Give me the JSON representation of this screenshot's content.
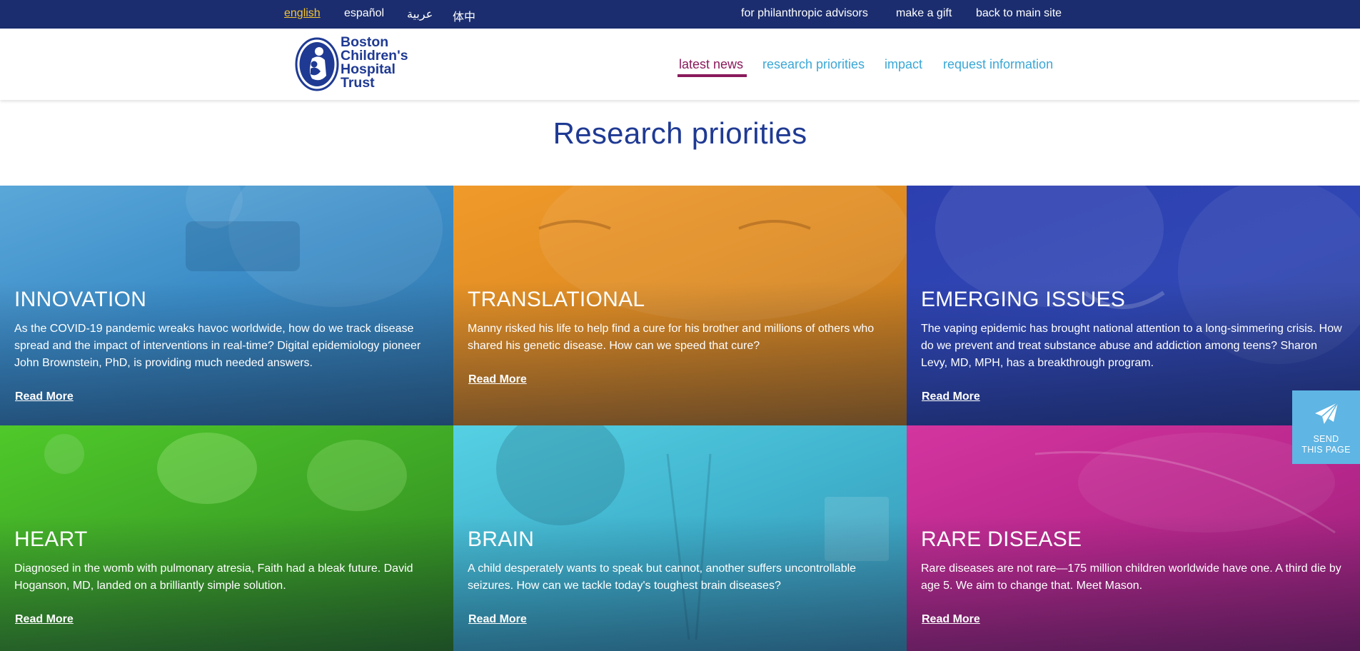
{
  "topbar": {
    "languages": [
      "english",
      "español",
      "عربية",
      "体中"
    ],
    "links": [
      "for philanthropic advisors",
      "make a gift",
      "back to main site"
    ]
  },
  "header": {
    "logo_lines": [
      "Boston",
      "Children's",
      "Hospital",
      "Trust"
    ],
    "nav": [
      "latest news",
      "research priorities",
      "impact",
      "request information"
    ]
  },
  "page": {
    "title": "Research priorities"
  },
  "tiles": [
    {
      "title": "INNOVATION",
      "text": "As the COVID-19 pandemic wreaks havoc worldwide, how do we track disease spread and the impact of interventions in real-time? Digital epidemiology pioneer John Brownstein, PhD, is providing much needed answers.",
      "link": "Read More",
      "color": "#3b8cc7"
    },
    {
      "title": "TRANSLATIONAL",
      "text": "Manny risked his life to help find a cure for his brother and millions of others who shared his genetic disease. How can we speed that cure?",
      "link": "Read More",
      "color": "#e0891f"
    },
    {
      "title": "EMERGING ISSUES",
      "text": "The vaping epidemic has brought national attention to a long-simmering crisis. How do we prevent and treat substance abuse and addiction among teens? Sharon Levy, MD, MPH, has a breakthrough program.",
      "link": "Read More",
      "color": "#3047b4"
    },
    {
      "title": "HEART",
      "text": "Diagnosed in the womb with pulmonary atresia, Faith had a bleak future. David Hoganson, MD, landed on a brilliantly simple solution.",
      "link": "Read More",
      "color": "#3ea626"
    },
    {
      "title": "BRAIN",
      "text": "A child desperately wants to speak but cannot, another suffers uncontrollable seizures. How can we tackle today's toughest brain diseases?",
      "link": "Read More",
      "color": "#3fb1cc"
    },
    {
      "title": "RARE DISEASE",
      "text": "Rare diseases are not rare—175 million children worldwide have one. A third die by age 5. We aim to change that. Meet Mason.",
      "link": "Read More",
      "color": "#b8278c"
    }
  ],
  "send_page": {
    "line1": "SEND",
    "line2": "THIS PAGE",
    "icon": "paper-plane-icon"
  },
  "colors": {
    "topbar": "#1b2d6e",
    "brand_blue": "#1f3a93",
    "nav_link": "#3aa7d6",
    "nav_active": "#8a1a5c",
    "lang_active": "#f6c42d"
  }
}
